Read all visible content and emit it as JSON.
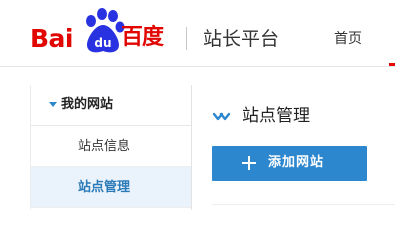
{
  "header": {
    "logo": {
      "text_latin": "Bai",
      "paw_text": "du",
      "text_cn": "百度"
    },
    "site_name": "站长平台",
    "nav": {
      "home_label": "首页"
    }
  },
  "sidebar": {
    "section_label": "我的网站",
    "items": [
      {
        "label": "站点信息",
        "active": false
      },
      {
        "label": "站点管理",
        "active": true
      }
    ]
  },
  "main": {
    "title": "站点管理",
    "add_button_label": "添加网站"
  },
  "colors": {
    "brand_red": "#e10602",
    "brand_blue": "#2932e1",
    "button_blue": "#2d87cf",
    "active_bg": "#eaf3fb",
    "active_text": "#2a7ab8"
  },
  "icons": {
    "logo": "baidu-paw-logo",
    "section_toggle": "caret-down-icon",
    "title_icon": "chevron-down-icon",
    "add_icon": "plus-icon"
  }
}
